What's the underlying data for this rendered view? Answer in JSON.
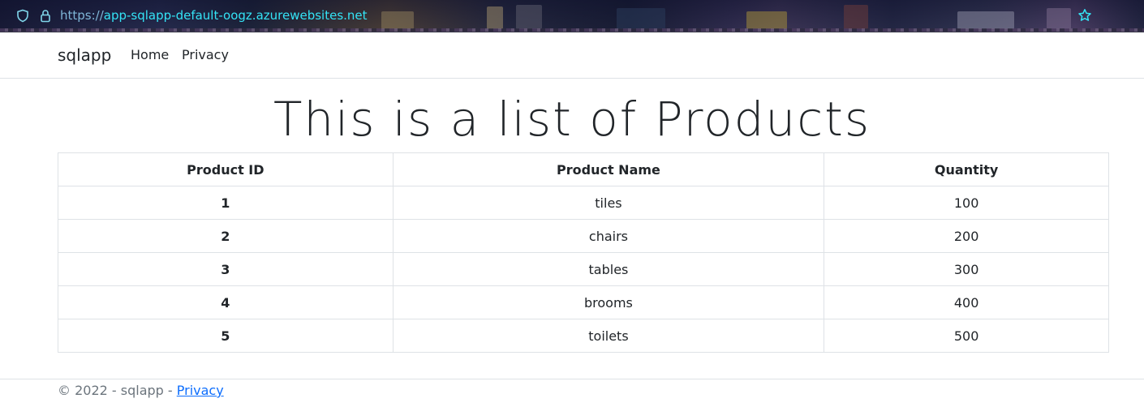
{
  "browser": {
    "url_scheme": "https://",
    "url_host": "app-sqlapp-default-oogz.azurewebsites.net",
    "icons": [
      "shield-icon",
      "lock-icon",
      "star-icon"
    ]
  },
  "navbar": {
    "brand": "sqlapp",
    "links": [
      {
        "label": "Home"
      },
      {
        "label": "Privacy"
      }
    ]
  },
  "main": {
    "title": "This is a list of Products",
    "table": {
      "headers": [
        "Product ID",
        "Product Name",
        "Quantity"
      ],
      "rows": [
        [
          "1",
          "tiles",
          "100"
        ],
        [
          "2",
          "chairs",
          "200"
        ],
        [
          "3",
          "tables",
          "300"
        ],
        [
          "4",
          "brooms",
          "400"
        ],
        [
          "5",
          "toilets",
          "500"
        ]
      ]
    }
  },
  "footer": {
    "text": "© 2022 - sqlapp - ",
    "link": "Privacy"
  },
  "colors": {
    "link": "#0d6efd",
    "url_host": "#34e3f5",
    "text": "#212529",
    "muted": "#6c757d",
    "border": "#dee2e6"
  }
}
